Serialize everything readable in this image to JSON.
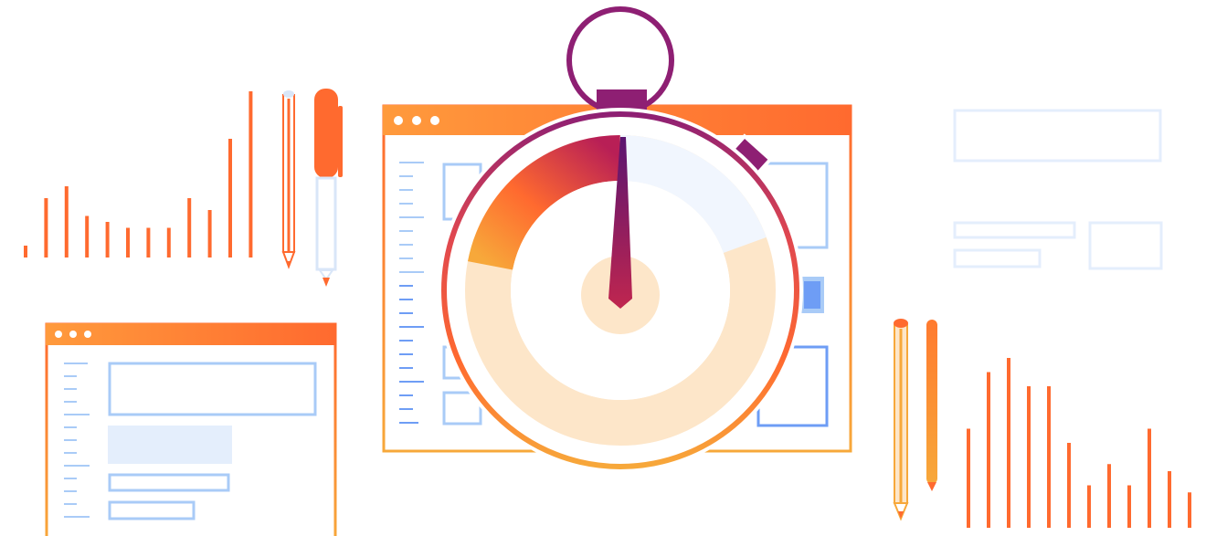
{
  "illustration": {
    "colors": {
      "orange": "#FF6A2F",
      "orange_light": "#FF9A3C",
      "gold": "#F7A83A",
      "magenta": "#8E1F73",
      "crimson": "#C0264F",
      "peach": "#FDE6C9",
      "pale_blue": "#F1F6FE",
      "line_blue": "#A9CBF7",
      "deep_blue": "#6E9DF5",
      "faint_blue": "#E4EEFC"
    },
    "stopwatch": {
      "window_dots": 3,
      "progress_fraction": 0.22
    },
    "left_bars": [
      1,
      5,
      6,
      3.5,
      3,
      2.5,
      2.5,
      2.5,
      5,
      4,
      10,
      14
    ],
    "right_bars": [
      7,
      11,
      12,
      10,
      10,
      6,
      3,
      4.5,
      3,
      7,
      4,
      2.5
    ],
    "icons": [
      "pencil-icon",
      "marker-icon",
      "stopwatch-icon",
      "browser-window-icon"
    ]
  }
}
